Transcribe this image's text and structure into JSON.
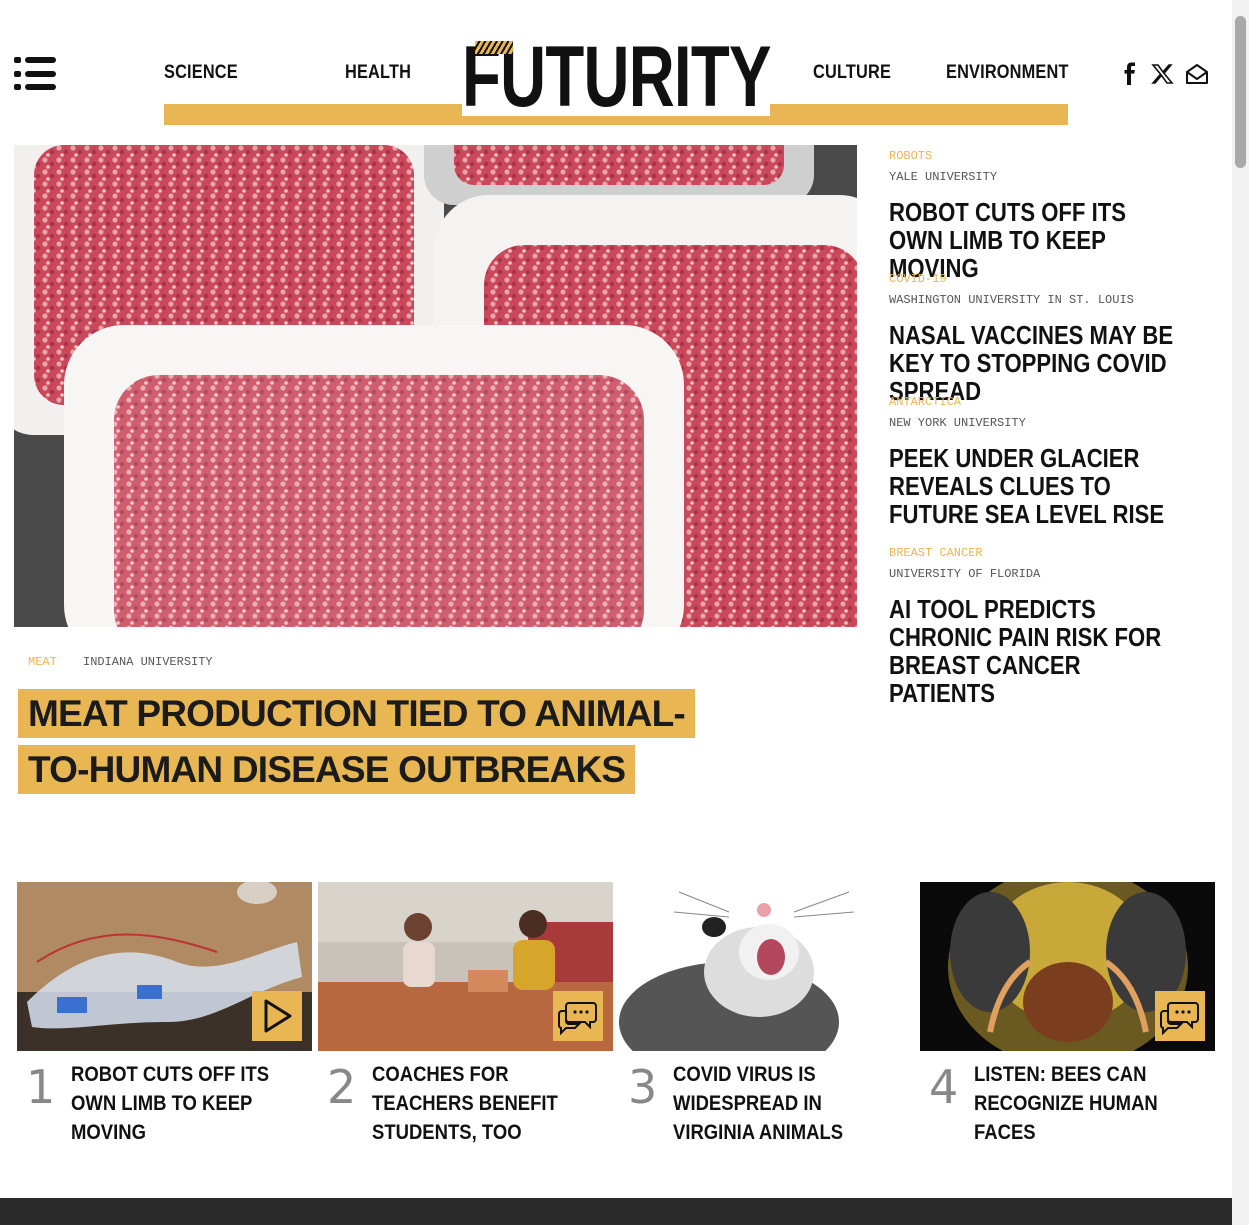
{
  "header": {
    "brand": "FUTURITY",
    "nav": {
      "science": "SCIENCE",
      "health": "HEALTH",
      "culture": "CULTURE",
      "environment": "ENVIRONMENT"
    },
    "accent_color": "#e8b754"
  },
  "social": [
    "facebook-icon",
    "x-icon",
    "email-icon"
  ],
  "hero": {
    "category": "MEAT",
    "university": "INDIANA UNIVERSITY",
    "title": "MEAT PRODUCTION TIED TO ANIMAL-TO-HUMAN DISEASE OUTBREAKS"
  },
  "sidebar": [
    {
      "category": "ROBOTS",
      "university": "YALE UNIVERSITY",
      "title": "ROBOT CUTS OFF ITS OWN LIMB TO KEEP MOVING"
    },
    {
      "category": "COVID-19",
      "university": "WASHINGTON UNIVERSITY IN ST. LOUIS",
      "title": "NASAL VACCINES MAY BE KEY TO STOPPING COVID SPREAD"
    },
    {
      "category": "ANTARCTICA",
      "university": "NEW YORK UNIVERSITY",
      "title": "PEEK UNDER GLACIER REVEALS CLUES TO FUTURE SEA LEVEL RISE"
    },
    {
      "category": "BREAST CANCER",
      "university": "UNIVERSITY OF FLORIDA",
      "title": "AI TOOL PREDICTS CHRONIC PAIN RISK FOR BREAST CANCER PATIENTS"
    }
  ],
  "popular": [
    {
      "rank": "1",
      "title": "ROBOT CUTS OFF ITS OWN LIMB TO KEEP MOVING",
      "badge": "play-icon"
    },
    {
      "rank": "2",
      "title": "COACHES FOR TEACHERS BENEFIT STUDENTS, TOO",
      "badge": "comments-icon"
    },
    {
      "rank": "3",
      "title": "COVID VIRUS IS WIDESPREAD IN VIRGINIA ANIMALS",
      "badge": ""
    },
    {
      "rank": "4",
      "title": "LISTEN: BEES CAN RECOGNIZE HUMAN FACES",
      "badge": "comments-icon"
    }
  ]
}
